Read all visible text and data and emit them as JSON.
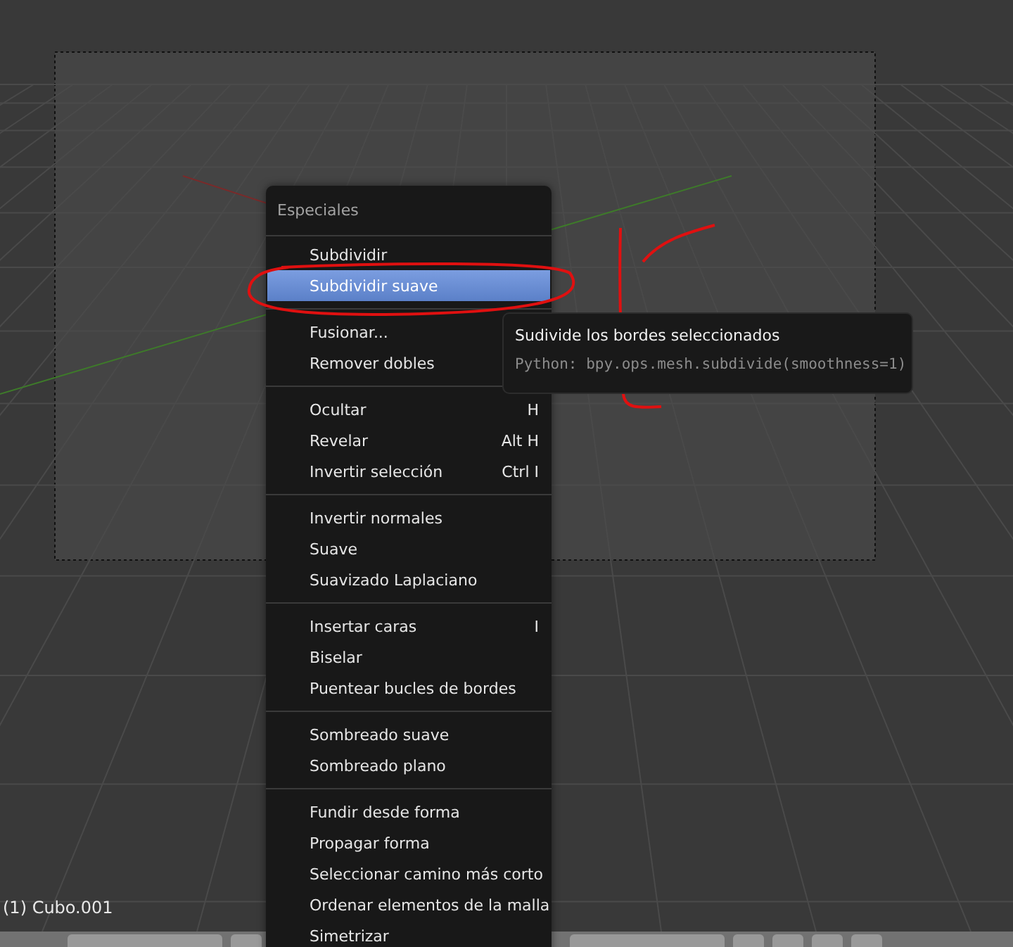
{
  "menu": {
    "title": "Especiales",
    "groups": [
      [
        {
          "label": "Subdividir",
          "selected": false
        },
        {
          "label": "Subdividir suave",
          "selected": true
        }
      ],
      [
        {
          "label": "Fusionar...",
          "selected": false
        },
        {
          "label": "Remover dobles",
          "selected": false
        }
      ],
      [
        {
          "label": "Ocultar",
          "shortcut": "H",
          "selected": false
        },
        {
          "label": "Revelar",
          "shortcut": "Alt H",
          "selected": false
        },
        {
          "label": "Invertir selección",
          "shortcut": "Ctrl I",
          "selected": false
        }
      ],
      [
        {
          "label": "Invertir normales",
          "selected": false
        },
        {
          "label": "Suave",
          "selected": false
        },
        {
          "label": "Suavizado Laplaciano",
          "selected": false
        }
      ],
      [
        {
          "label": "Insertar caras",
          "shortcut": "I",
          "selected": false
        },
        {
          "label": "Biselar",
          "selected": false
        },
        {
          "label": "Puentear bucles de bordes",
          "selected": false
        }
      ],
      [
        {
          "label": "Sombreado suave",
          "selected": false
        },
        {
          "label": "Sombreado plano",
          "selected": false
        }
      ],
      [
        {
          "label": "Fundir desde forma",
          "selected": false
        },
        {
          "label": "Propagar forma",
          "selected": false
        },
        {
          "label": "Seleccionar camino más corto",
          "selected": false
        },
        {
          "label": "Ordenar elementos de la malla",
          "selected": false
        },
        {
          "label": "Simetrizar",
          "selected": false
        }
      ]
    ]
  },
  "tooltip": {
    "title": "Sudivide los bordes seleccionados",
    "python": "Python: bpy.ops.mesh.subdivide(smoothness=1)"
  },
  "viewport": {
    "object_label": "(1) Cubo.001"
  }
}
